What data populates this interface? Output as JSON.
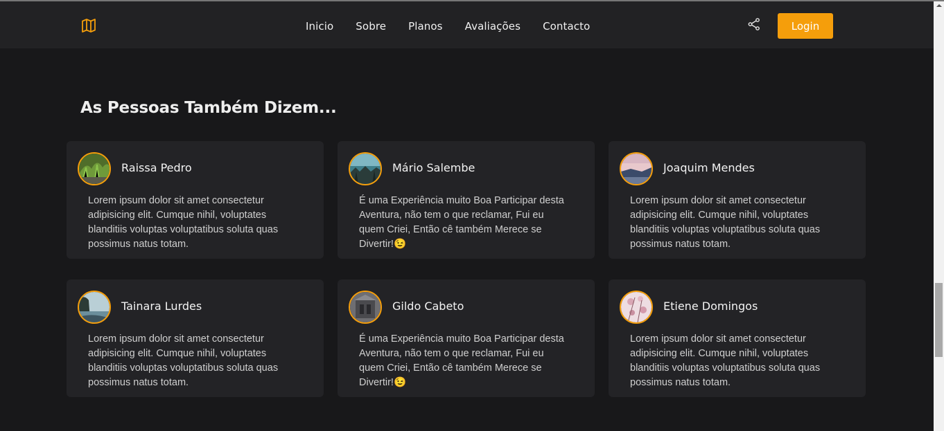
{
  "header": {
    "logo_icon": "map-icon",
    "nav": [
      "Inicio",
      "Sobre",
      "Planos",
      "Avaliações",
      "Contacto"
    ],
    "share_icon": "share-icon",
    "login_label": "Login",
    "accent": "#f59e0b"
  },
  "section": {
    "title": "As Pessoas Também Dizem..."
  },
  "reviews": [
    {
      "name": "Raissa Pedro",
      "text": "Lorem ipsum dolor sit amet consectetur adipisicing elit. Cumque nihil, voluptates blanditiis voluptas voluptatibus soluta quas possimus natus totam."
    },
    {
      "name": "Mário Salembe",
      "text": "É uma Experiência muito Boa Participar desta Aventura, não tem o que reclamar, Fui eu quem Criei, Então cê também Merece se Divertir!😉"
    },
    {
      "name": "Joaquim Mendes",
      "text": "Lorem ipsum dolor sit amet consectetur adipisicing elit. Cumque nihil, voluptates blanditiis voluptas voluptatibus soluta quas possimus natus totam."
    },
    {
      "name": "Tainara Lurdes",
      "text": "Lorem ipsum dolor sit amet consectetur adipisicing elit. Cumque nihil, voluptates blanditiis voluptas voluptatibus soluta quas possimus natus totam."
    },
    {
      "name": "Gildo Cabeto",
      "text": "É uma Experiência muito Boa Participar desta Aventura, não tem o que reclamar, Fui eu quem Criei, Então cê também Merece se Divertir!😉"
    },
    {
      "name": "Etiene Domingos",
      "text": "Lorem ipsum dolor sit amet consectetur adipisicing elit. Cumque nihil, voluptates blanditiis voluptas voluptatibus soluta quas possimus natus totam."
    }
  ]
}
